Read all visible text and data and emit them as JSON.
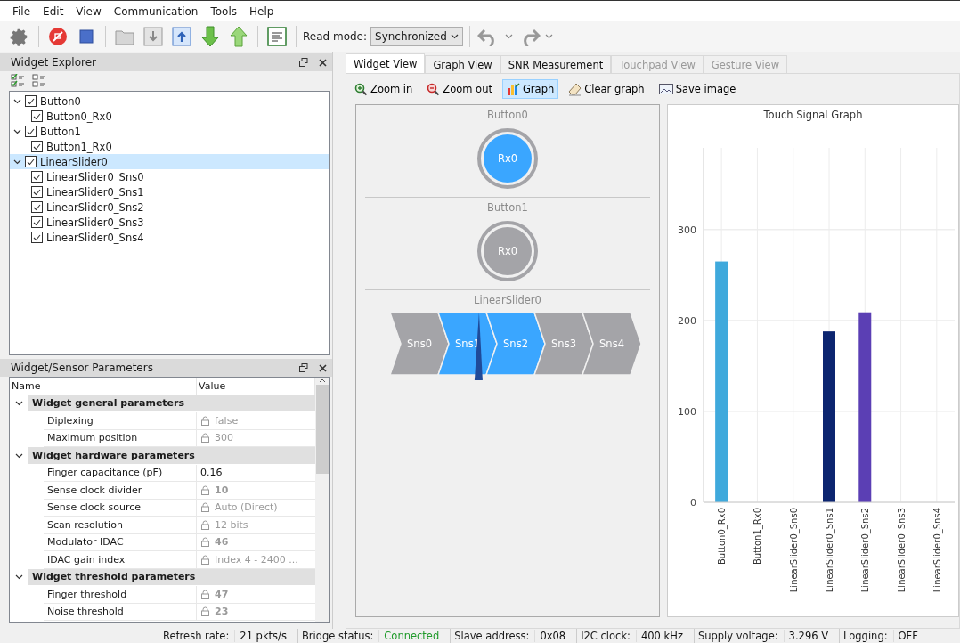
{
  "menu": [
    {
      "label": "File"
    },
    {
      "label": "Edit"
    },
    {
      "label": "View"
    },
    {
      "label": "Communication"
    },
    {
      "label": "Tools"
    },
    {
      "label": "Help"
    }
  ],
  "toolbar": {
    "read_mode_label": "Read mode:",
    "read_mode_value": "Synchronized"
  },
  "widget_explorer": {
    "title": "Widget Explorer",
    "tree": [
      {
        "label": "Button0",
        "checked": true,
        "expanded": true,
        "selected": false,
        "children": [
          {
            "label": "Button0_Rx0",
            "checked": true,
            "selected": false
          }
        ]
      },
      {
        "label": "Button1",
        "checked": true,
        "expanded": true,
        "selected": false,
        "children": [
          {
            "label": "Button1_Rx0",
            "checked": true,
            "selected": false
          }
        ]
      },
      {
        "label": "LinearSlider0",
        "checked": true,
        "expanded": true,
        "selected": true,
        "children": [
          {
            "label": "LinearSlider0_Sns0",
            "checked": true,
            "selected": false
          },
          {
            "label": "LinearSlider0_Sns1",
            "checked": true,
            "selected": false
          },
          {
            "label": "LinearSlider0_Sns2",
            "checked": true,
            "selected": false
          },
          {
            "label": "LinearSlider0_Sns3",
            "checked": true,
            "selected": false
          },
          {
            "label": "LinearSlider0_Sns4",
            "checked": true,
            "selected": false
          }
        ]
      }
    ]
  },
  "parameters": {
    "title": "Widget/Sensor Parameters",
    "columns": [
      "Name",
      "Value"
    ],
    "groups": [
      {
        "label": "Widget general parameters",
        "expanded": true,
        "rows": [
          {
            "name": "Diplexing",
            "value": "false",
            "locked": true,
            "bold": false
          },
          {
            "name": "Maximum position",
            "value": "300",
            "locked": true,
            "bold": false
          }
        ]
      },
      {
        "label": "Widget hardware parameters",
        "expanded": true,
        "rows": [
          {
            "name": "Finger capacitance (pF)",
            "value": "0.16",
            "locked": false,
            "bold": false
          },
          {
            "name": "Sense clock divider",
            "value": "10",
            "locked": true,
            "bold": true
          },
          {
            "name": "Sense clock source",
            "value": "Auto (Direct)",
            "locked": true,
            "bold": false
          },
          {
            "name": "Scan resolution",
            "value": "12 bits",
            "locked": true,
            "bold": false
          },
          {
            "name": "Modulator IDAC",
            "value": "46",
            "locked": true,
            "bold": true
          },
          {
            "name": "IDAC gain index",
            "value": "Index 4 - 2400 ...",
            "locked": true,
            "bold": false
          }
        ]
      },
      {
        "label": "Widget threshold parameters",
        "expanded": true,
        "rows": [
          {
            "name": "Finger threshold",
            "value": "47",
            "locked": true,
            "bold": true
          },
          {
            "name": "Noise threshold",
            "value": "23",
            "locked": true,
            "bold": true
          }
        ]
      }
    ]
  },
  "tabs": [
    {
      "label": "Widget View",
      "selected": true,
      "disabled": false
    },
    {
      "label": "Graph View",
      "selected": false,
      "disabled": false
    },
    {
      "label": "SNR Measurement",
      "selected": false,
      "disabled": false
    },
    {
      "label": "Touchpad View",
      "selected": false,
      "disabled": true
    },
    {
      "label": "Gesture View",
      "selected": false,
      "disabled": true
    }
  ],
  "view_toolbar": [
    {
      "label": "Zoom in",
      "kind": "zoom-in",
      "pressed": false
    },
    {
      "label": "Zoom out",
      "kind": "zoom-out",
      "pressed": false
    },
    {
      "label": "Graph",
      "kind": "graph",
      "pressed": true
    },
    {
      "label": "Clear graph",
      "kind": "clear",
      "pressed": false
    },
    {
      "label": "Save image",
      "kind": "save",
      "pressed": false
    }
  ],
  "widgets": [
    {
      "kind": "button",
      "title": "Button0",
      "sensor": "Rx0",
      "active": true
    },
    {
      "kind": "button",
      "title": "Button1",
      "sensor": "Rx0",
      "active": false
    },
    {
      "kind": "slider",
      "title": "LinearSlider0",
      "level": 0.37,
      "segments": [
        {
          "label": "Sns0",
          "active": false
        },
        {
          "label": "Sns1",
          "active": true
        },
        {
          "label": "Sns2",
          "active": true
        },
        {
          "label": "Sns3",
          "active": false
        },
        {
          "label": "Sns4",
          "active": false
        }
      ]
    }
  ],
  "graph": {
    "chart_data": {
      "type": "bar",
      "title": "Touch Signal Graph",
      "categories": [
        "Button0_Rx0",
        "Button1_Rx0",
        "LinearSlider0_Sns0",
        "LinearSlider0_Sns1",
        "LinearSlider0_Sns2",
        "LinearSlider0_Sns3",
        "LinearSlider0_Sns4"
      ],
      "series": [
        {
          "color": "#3fa9dc",
          "values": [
            265,
            null,
            null,
            null,
            null,
            null,
            null
          ]
        },
        {
          "color": "#0c2570",
          "values": [
            null,
            null,
            null,
            188,
            null,
            null,
            null
          ]
        },
        {
          "color": "#5b3fb4",
          "values": [
            null,
            null,
            null,
            null,
            209,
            null,
            null
          ]
        }
      ],
      "stacked": true,
      "grid": true,
      "ylim": [
        0,
        390
      ],
      "yticks": [
        0,
        100,
        200,
        300
      ]
    }
  },
  "status_bar": [
    {
      "label": "Refresh rate:",
      "value": "21 pkts/s",
      "kind": "normal"
    },
    {
      "label": "Bridge status:",
      "value": "Connected",
      "kind": "ok"
    },
    {
      "label": "Slave address:",
      "value": "0x08",
      "kind": "normal"
    },
    {
      "label": "I2C clock:",
      "value": "400 kHz",
      "kind": "normal"
    },
    {
      "label": "Supply voltage:",
      "value": "3.296 V",
      "kind": "normal"
    },
    {
      "label": "Logging:",
      "value": "OFF",
      "kind": "normal"
    }
  ]
}
